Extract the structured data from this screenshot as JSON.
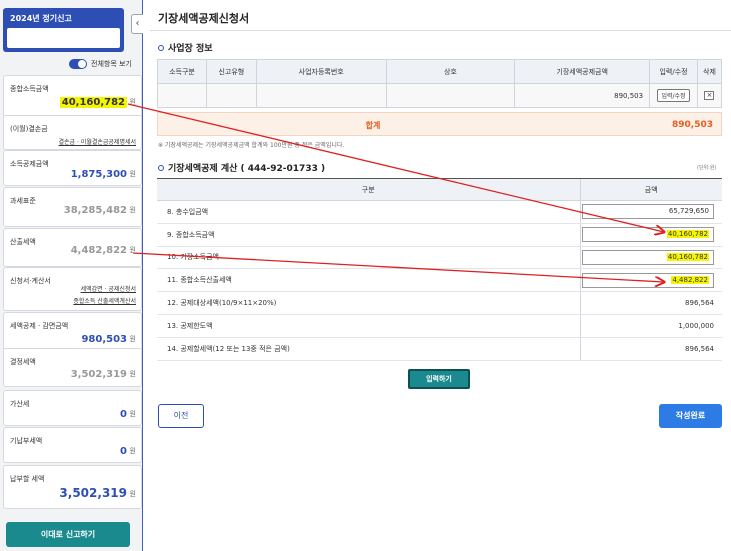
{
  "sidebar": {
    "year_title": "2024년 정기신고",
    "year_input_value": "",
    "collapse_glyph": "‹",
    "toggle_label": "전체항목 보기",
    "toggle_on": true,
    "cards": {
      "income": {
        "label": "종합소득금액",
        "value": "40,160,782",
        "unit": "원"
      },
      "deficit": {
        "label": "(이월)결손금",
        "link": "결손금 · 이월결손금공제명세서"
      },
      "deduction": {
        "label": "소득공제금액",
        "value": "1,875,300",
        "unit": "원"
      },
      "tax_base": {
        "label": "과세표준",
        "value": "38,285,482",
        "unit": "원"
      },
      "calc_tax": {
        "label": "산출세액",
        "value": "4,482,822",
        "unit": "원"
      },
      "forms": {
        "label": "신청서·계산서",
        "link1": "세액감면 · 공제신청서",
        "link2": "종합소득 산출세액계산서"
      },
      "credit": {
        "label": "세액공제 · 감면금액",
        "value": "980,503",
        "unit": "원"
      },
      "determined": {
        "label": "결정세액",
        "value": "3,502,319",
        "unit": "원"
      },
      "additional": {
        "label": "가산세",
        "value": "0",
        "unit": "원"
      },
      "prepaid": {
        "label": "기납부세액",
        "value": "0",
        "unit": "원"
      },
      "payable": {
        "label": "납부할 세액",
        "value": "3,502,319",
        "unit": "원"
      }
    },
    "report_button": "이대로 신고하기"
  },
  "main": {
    "page_title": "기장세액공제신청서",
    "biz_section_title": "사업장 정보",
    "biz_table": {
      "headers": [
        "소득구분",
        "신고유형",
        "사업자등록번호",
        "상호",
        "기장세액공제금액",
        "입력/수정",
        "삭제"
      ],
      "row": {
        "income_type": "",
        "report_type": "",
        "reg_no": "",
        "name": "",
        "amount": "890,503",
        "edit": "입력/수정",
        "delete": "×"
      }
    },
    "sum": {
      "label": "합계",
      "value": "890,503"
    },
    "note": "※ 기장세액공제는 기장세액공제금액 합계와 100만원 중 적은 금액입니다.",
    "calc_section_title": "기장세액공제 계산 ( 444-92-01733 )",
    "unit_note": "(단위:원)",
    "calc_table": {
      "headers": [
        "구분",
        "금액"
      ],
      "rows": [
        {
          "label": "8. 총수입금액",
          "value": "65,729,650"
        },
        {
          "label": "9. 종합소득금액",
          "value": "40,160,782"
        },
        {
          "label": "10. 기장소득금액",
          "value": "40,160,782"
        },
        {
          "label": "11. 종합소득산출세액",
          "value": "4,482,822"
        },
        {
          "label": "12. 공제대상세액(10/9×11×20%)",
          "value": "896,564"
        },
        {
          "label": "13. 공제한도액",
          "value": "1,000,000"
        },
        {
          "label": "14. 공제할세액(12 또는 13중 적은 금액)",
          "value": "896,564"
        }
      ]
    },
    "enter_button": "입력하기",
    "prev_button": "이전",
    "done_button": "작성완료"
  },
  "colors": {
    "primary": "#2d4fb5",
    "teal": "#1a8a8f",
    "highlight": "#f5f500",
    "sum_orange": "#e85a1e",
    "annotation_red": "#e02020"
  }
}
